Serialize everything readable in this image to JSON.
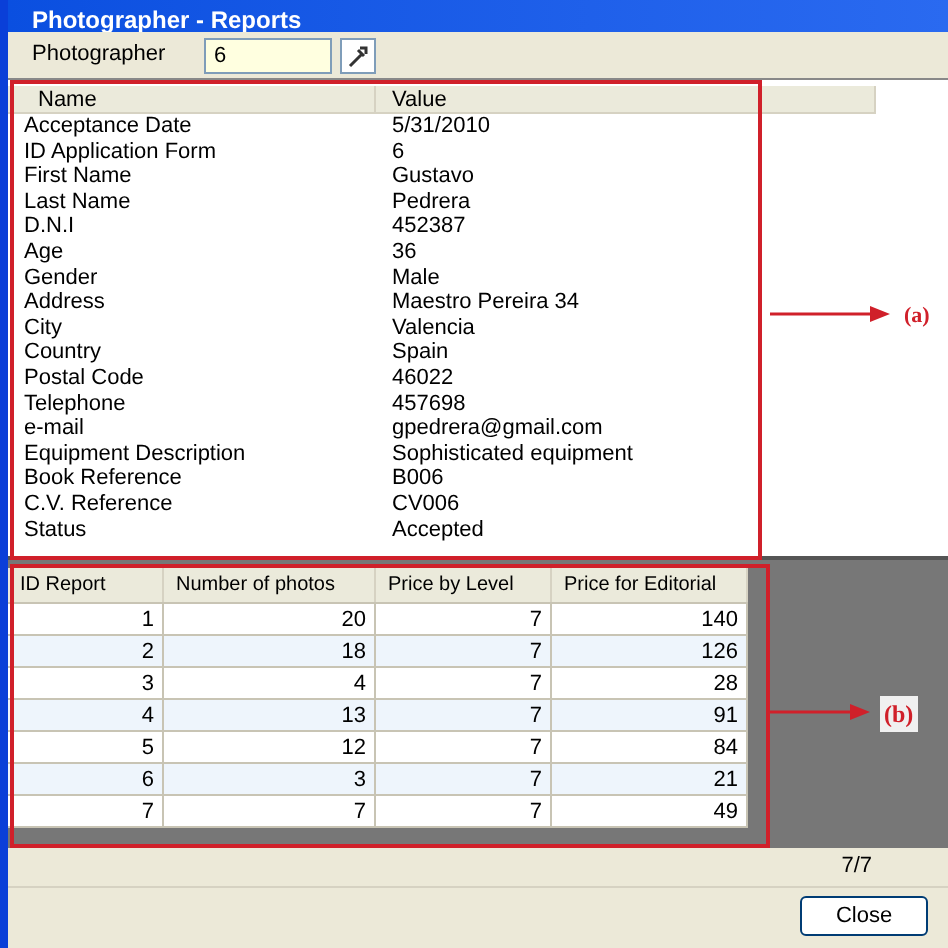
{
  "window": {
    "title": "Photographer - Reports"
  },
  "toolbar": {
    "label": "Photographer",
    "value": "6"
  },
  "properties": {
    "columns": [
      "Name",
      "Value"
    ],
    "rows": [
      [
        "Acceptance Date",
        "5/31/2010"
      ],
      [
        "ID Application Form",
        "6"
      ],
      [
        "First Name",
        "Gustavo"
      ],
      [
        "Last Name",
        "Pedrera"
      ],
      [
        "D.N.I",
        "452387"
      ],
      [
        "Age",
        "36"
      ],
      [
        "Gender",
        "Male"
      ],
      [
        "Address",
        "Maestro Pereira 34"
      ],
      [
        "City",
        "Valencia"
      ],
      [
        "Country",
        "Spain"
      ],
      [
        "Postal Code",
        "46022"
      ],
      [
        "Telephone",
        "457698"
      ],
      [
        "e-mail",
        "gpedrera@gmail.com"
      ],
      [
        "Equipment Description",
        "Sophisticated equipment"
      ],
      [
        "Book Reference",
        "B006"
      ],
      [
        "C.V. Reference",
        "CV006"
      ],
      [
        "Status",
        "Accepted"
      ]
    ]
  },
  "reports": {
    "columns": [
      "ID Report",
      "Number of photos",
      "Price by Level",
      "Price for Editorial"
    ],
    "rows": [
      [
        "1",
        "20",
        "7",
        "140"
      ],
      [
        "2",
        "18",
        "7",
        "126"
      ],
      [
        "3",
        "4",
        "7",
        "28"
      ],
      [
        "4",
        "13",
        "7",
        "91"
      ],
      [
        "5",
        "12",
        "7",
        "84"
      ],
      [
        "6",
        "3",
        "7",
        "21"
      ],
      [
        "7",
        "7",
        "7",
        "49"
      ]
    ]
  },
  "status_bar": {
    "text": "7/7"
  },
  "buttons": [
    "Close"
  ],
  "annotations": [
    "(a)",
    "(b)"
  ]
}
